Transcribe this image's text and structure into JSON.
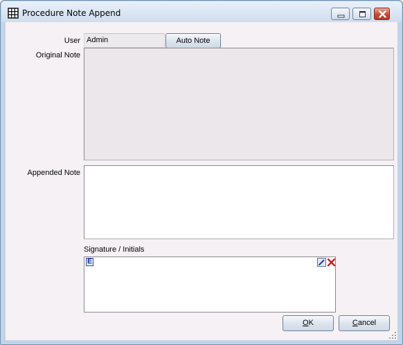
{
  "window": {
    "title": "Procedure Note Append",
    "icon": "grid-icon",
    "caption_buttons": [
      "minimize-icon",
      "maximize-icon",
      "close-icon"
    ]
  },
  "form": {
    "user_label": "User",
    "user_value": "Admin",
    "auto_note_button": "Auto Note",
    "original_note_label": "Original Note",
    "original_note_value": "",
    "appended_note_label": "Appended Note",
    "appended_note_value": "",
    "signature_label": "Signature / Initials",
    "signature_badge": "E",
    "signature_tools": [
      "edit-pen-icon",
      "clear-x-icon"
    ]
  },
  "buttons": {
    "ok_label": "OK",
    "ok_mnemonic": "O",
    "cancel_label": "Cancel",
    "cancel_mnemonic": "C"
  },
  "colors": {
    "frame": "#c3d4e7",
    "client_background": "#f5f1f4",
    "close_button": "#c84a35",
    "button_border": "#6b7e9a"
  }
}
